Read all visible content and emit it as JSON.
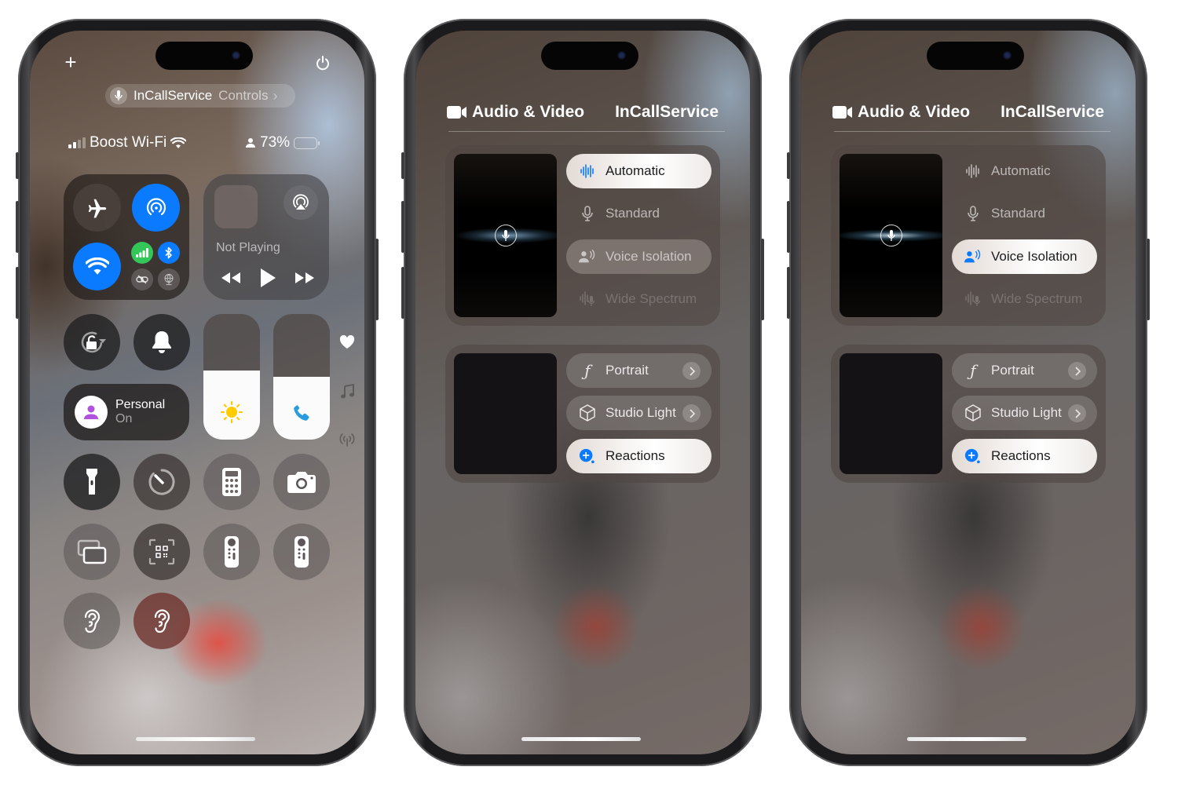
{
  "phones": [
    {
      "screen": "control-center",
      "top_pill": {
        "app": "InCallService",
        "label": "Controls"
      },
      "status_bar": {
        "carrier": "Boost Wi-Fi",
        "signal_bars": 2,
        "signal_bars_total": 4,
        "battery_percent": "73%",
        "battery_level": 0.73
      },
      "connectivity": {
        "airplane_mode": false,
        "airdrop": true,
        "wifi": true,
        "cellular": true,
        "bluetooth": true,
        "personal_hotspot": false,
        "vpn": false
      },
      "media": {
        "status": "Not Playing"
      },
      "focus": {
        "name": "Personal",
        "state": "On"
      },
      "brightness_level": 0.55,
      "volume_level": 0.5,
      "side_icons": [
        "heart-icon",
        "music-note-icon",
        "broadcast-icon"
      ],
      "grid_controls": [
        "flashlight",
        "timer",
        "calculator",
        "camera",
        "screen-mirroring",
        "code-scanner",
        "apple-tv-remote",
        "apple-tv-remote-2",
        "hearing",
        "live-listen"
      ]
    },
    {
      "screen": "audio-video",
      "header": {
        "left": "Audio & Video",
        "right": "InCallService"
      },
      "mic_modes": [
        {
          "label": "Automatic",
          "state": "selected"
        },
        {
          "label": "Standard",
          "state": "normal"
        },
        {
          "label": "Voice Isolation",
          "state": "highlighted"
        },
        {
          "label": "Wide Spectrum",
          "state": "disabled"
        }
      ],
      "video_effects": [
        {
          "label": "Portrait",
          "has_chevron": true,
          "active": false
        },
        {
          "label": "Studio Light",
          "has_chevron": true,
          "active": false
        },
        {
          "label": "Reactions",
          "has_chevron": false,
          "active": true
        }
      ]
    },
    {
      "screen": "audio-video",
      "header": {
        "left": "Audio & Video",
        "right": "InCallService"
      },
      "mic_modes": [
        {
          "label": "Automatic",
          "state": "normal"
        },
        {
          "label": "Standard",
          "state": "normal"
        },
        {
          "label": "Voice Isolation",
          "state": "selected"
        },
        {
          "label": "Wide Spectrum",
          "state": "disabled"
        }
      ],
      "video_effects": [
        {
          "label": "Portrait",
          "has_chevron": true,
          "active": false
        },
        {
          "label": "Studio Light",
          "has_chevron": true,
          "active": false
        },
        {
          "label": "Reactions",
          "has_chevron": false,
          "active": true
        }
      ]
    }
  ],
  "colors": {
    "accent_blue": "#0a7aff",
    "cellular_green": "#33c759",
    "focus_purple": "#af52de",
    "sun_yellow": "#ffcc00",
    "phone_blue": "#2a9bdc"
  }
}
